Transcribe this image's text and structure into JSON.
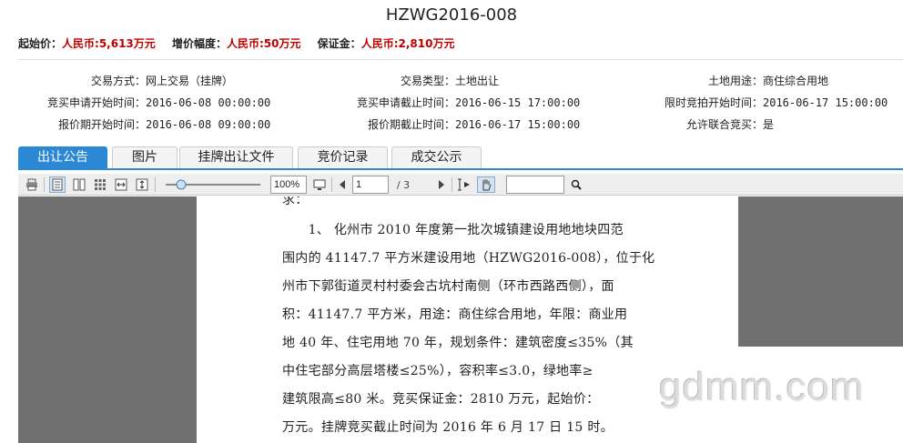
{
  "title": "HZWG2016-008",
  "prices": [
    {
      "label": "起始价：",
      "value": "人民币:5,613万元"
    },
    {
      "label": "增价幅度：",
      "value": "人民币:50万元"
    },
    {
      "label": "保证金：",
      "value": "人民币:2,810万元"
    }
  ],
  "info": {
    "trade_method_label": "交易方式：",
    "trade_method": "网上交易（挂牌）",
    "trade_type_label": "交易类型：",
    "trade_type": "土地出让",
    "land_use_label": "土地用途：",
    "land_use": "商住综合用地",
    "apply_start_label": "竞买申请开始时间：",
    "apply_start": "2016-06-08 00:00:00",
    "apply_end_label": "竞买申请截止时间：",
    "apply_end": "2016-06-15 17:00:00",
    "bid_start_label": "限时竞拍开始时间：",
    "bid_start": "2016-06-17 15:00:00",
    "quote_start_label": "报价期开始时间：",
    "quote_start": "2016-06-08 09:00:00",
    "quote_end_label": "报价期截止时间：",
    "quote_end": "2016-06-17 15:00:00",
    "joint_bid_label": "允许联合竞买：",
    "joint_bid": "是"
  },
  "tabs": [
    {
      "label": "出让公告",
      "active": true
    },
    {
      "label": "图片"
    },
    {
      "label": "挂牌出让文件"
    },
    {
      "label": "竞价记录"
    },
    {
      "label": "成交公示"
    }
  ],
  "toolbar": {
    "zoom": "100%",
    "page_current": "1",
    "page_total": "/ 3",
    "search_value": "",
    "icons": [
      "print-icon",
      "single-page-icon",
      "two-page-icon",
      "thumbnails-icon",
      "fit-width-icon",
      "fit-height-icon",
      "zoom-slider",
      "fullscreen-icon",
      "prev-page-icon",
      "next-page-icon",
      "text-select-icon",
      "hand-tool-icon",
      "search-icon"
    ]
  },
  "document": {
    "lines": [
      "求：",
      "　　1、 化州市 2010 年度第一批次城镇建设用地地块四范",
      "围内的 41147.7 平方米建设用地（HZWG2016-008），位于化",
      "州市下郭街道灵村村委会古坑村南侧（环市西路西侧），面",
      "积：41147.7 平方米，用途：商住综合用地，年限：商业用",
      "地 40 年、住宅用地 70 年，规划条件：建筑密度≤35%（其",
      "中住宅部分高层塔楼≤25%），容积率≤3.0，绿地率≥",
      "建筑限高≤80 米。竞买保证金：2810 万元，起始价：",
      "万元。挂牌竞买截止时间为 2016 年 6 月 17 日 15 时。"
    ]
  },
  "watermark": "gdmm.com",
  "colors": {
    "accent": "#2a88d4",
    "price": "#c00000",
    "viewer_bg": "#707070"
  }
}
